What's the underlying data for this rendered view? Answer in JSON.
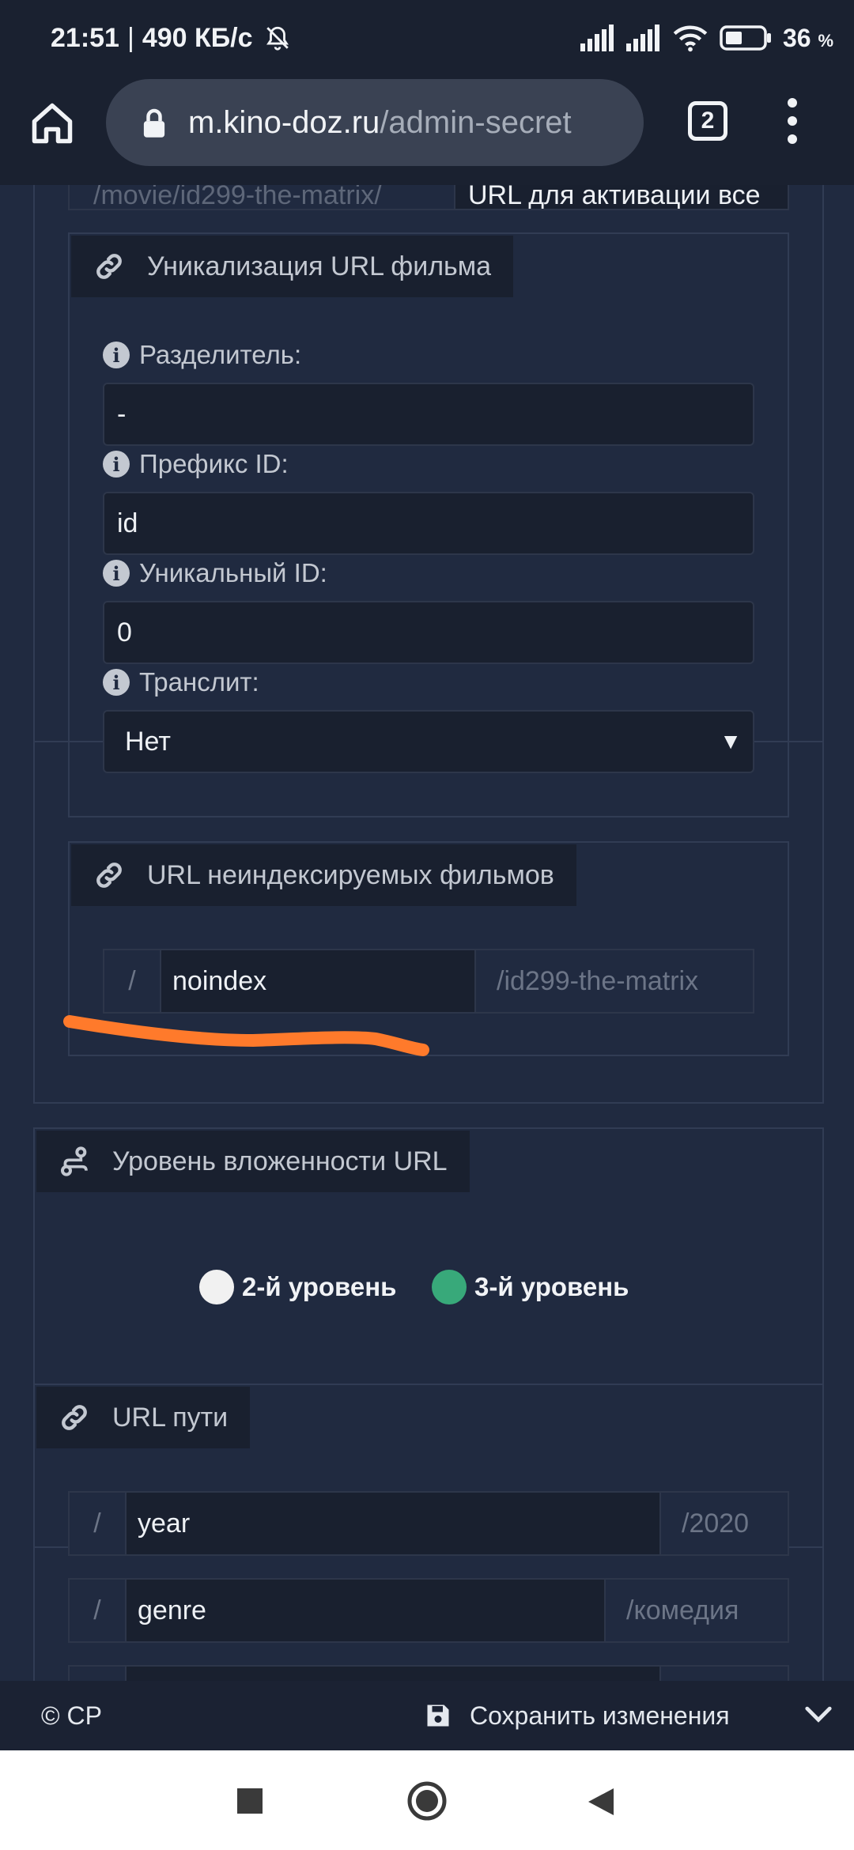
{
  "status_bar": {
    "time": "21:51",
    "separator": "|",
    "speed": "490 КБ/с",
    "battery_percent": "36",
    "battery_unit": "%"
  },
  "browser": {
    "url_host": "m.kino-doz.ru",
    "url_path": "/admin-secret",
    "tab_count": "2"
  },
  "top_partial_row": {
    "left_text": "/movie/id299-the-matrix/",
    "right_text": "URL для активации все"
  },
  "section_unique": {
    "title": "Уникализация URL фильма",
    "fields": [
      {
        "label": "Разделитель:",
        "value": "-"
      },
      {
        "label": "Префикс ID:",
        "value": "id"
      },
      {
        "label": "Уникальный ID:",
        "value": "0"
      }
    ],
    "translit_label": "Транслит:",
    "translit_value": "Нет",
    "select_arrow": "▼"
  },
  "section_noindex": {
    "title": "URL неиндексируемых фильмов",
    "prefix": "/",
    "value": "noindex",
    "suffix": "/id299-the-matrix"
  },
  "section_level": {
    "title": "Уровень вложенности URL",
    "options": [
      {
        "label": "2-й уровень",
        "color": "#f1f1f1",
        "selected": false
      },
      {
        "label": "3-й уровень",
        "color": "#38a97a",
        "selected": true
      }
    ]
  },
  "section_paths": {
    "title": "URL пути",
    "rows": [
      {
        "prefix": "/",
        "value": "year",
        "suffix": "/2020"
      },
      {
        "prefix": "/",
        "value": "genre",
        "suffix": "/комедия"
      }
    ]
  },
  "footer": {
    "copyright": "© CP",
    "save_label": "Сохранить изменения"
  },
  "colors": {
    "background": "#202a40",
    "legend_bg": "#19202f",
    "annotation_stroke": "#ff7a2b"
  }
}
